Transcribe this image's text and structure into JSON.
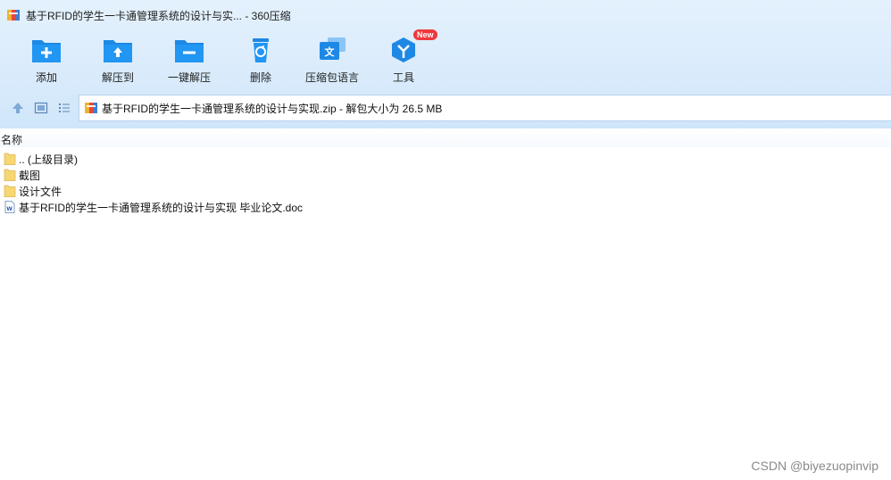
{
  "window": {
    "title": "基于RFID的学生一卡通管理系统的设计与实... - 360压缩"
  },
  "toolbar": {
    "items": [
      {
        "label": "添加",
        "icon": "add-icon"
      },
      {
        "label": "解压到",
        "icon": "extract-to-icon"
      },
      {
        "label": "一键解压",
        "icon": "one-click-extract-icon"
      },
      {
        "label": "删除",
        "icon": "delete-icon"
      },
      {
        "label": "压缩包语言",
        "icon": "archive-language-icon"
      },
      {
        "label": "工具",
        "icon": "tools-icon",
        "badge": "New"
      }
    ]
  },
  "address": {
    "text": "基于RFID的学生一卡通管理系统的设计与实现.zip - 解包大小为 26.5 MB"
  },
  "list": {
    "column_name": "名称",
    "items": [
      {
        "name": ".. (上级目录)",
        "type": "folder"
      },
      {
        "name": "截图",
        "type": "folder"
      },
      {
        "name": "设计文件",
        "type": "folder"
      },
      {
        "name": "基于RFID的学生一卡通管理系统的设计与实现 毕业论文.doc",
        "type": "doc"
      }
    ]
  },
  "watermark": "CSDN @biyezuopinvip",
  "colors": {
    "accent": "#1e88e5",
    "badge": "#f0383c",
    "folder": "#f7d774"
  }
}
